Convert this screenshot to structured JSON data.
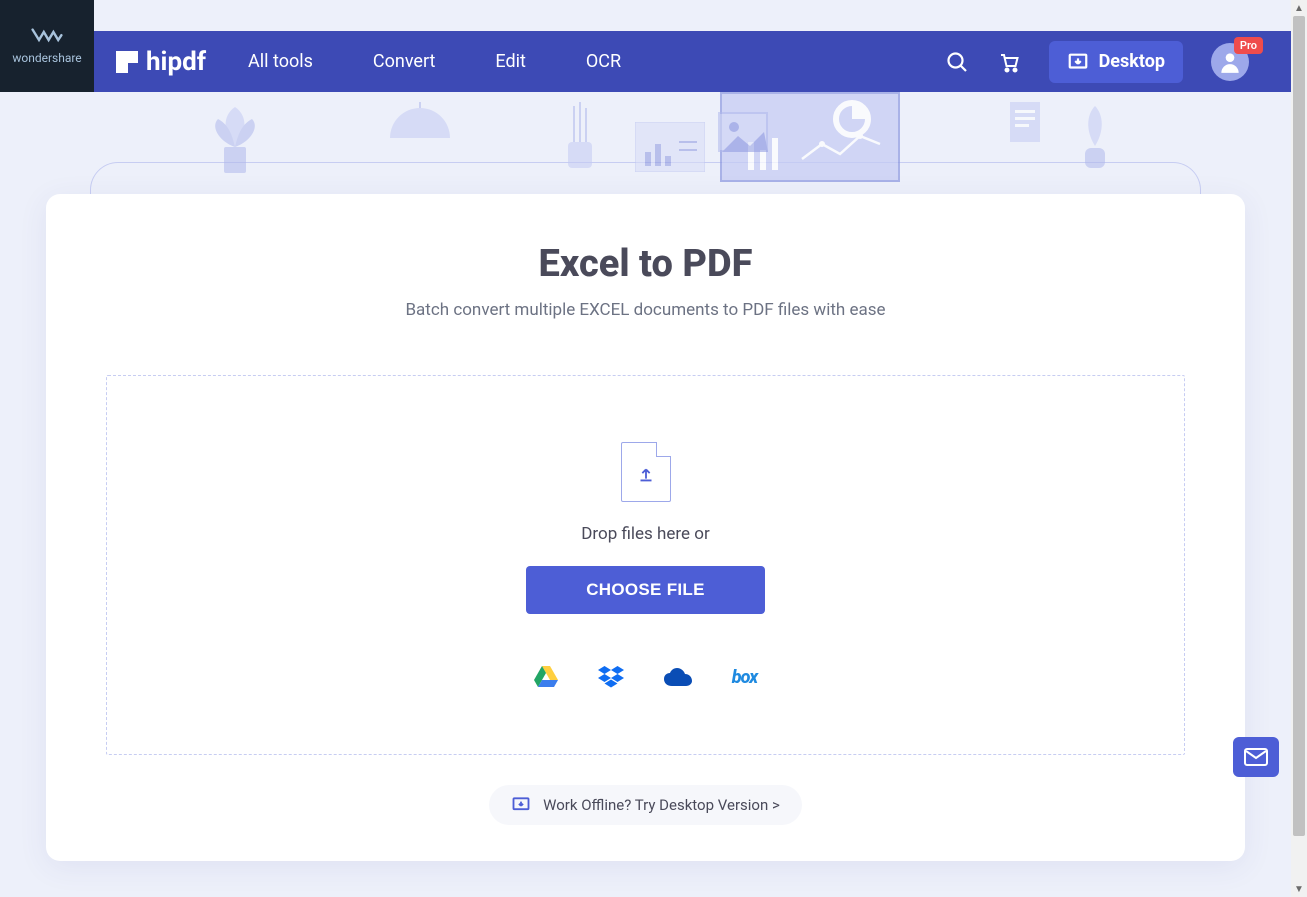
{
  "brand": {
    "parent": "wondershare",
    "product": "hipdf"
  },
  "nav": {
    "items": [
      "All tools",
      "Convert",
      "Edit",
      "OCR"
    ],
    "desktop_label": "Desktop",
    "pro_badge": "Pro"
  },
  "main": {
    "title": "Excel to PDF",
    "subtitle": "Batch convert multiple EXCEL documents to PDF files with ease",
    "drop_text": "Drop files here or",
    "choose_file_label": "CHOOSE FILE",
    "cloud_sources": {
      "gdrive": "Google Drive",
      "dropbox": "Dropbox",
      "onedrive": "OneDrive",
      "box_label": "box"
    },
    "offline_text": "Work Offline? Try Desktop Version >"
  }
}
